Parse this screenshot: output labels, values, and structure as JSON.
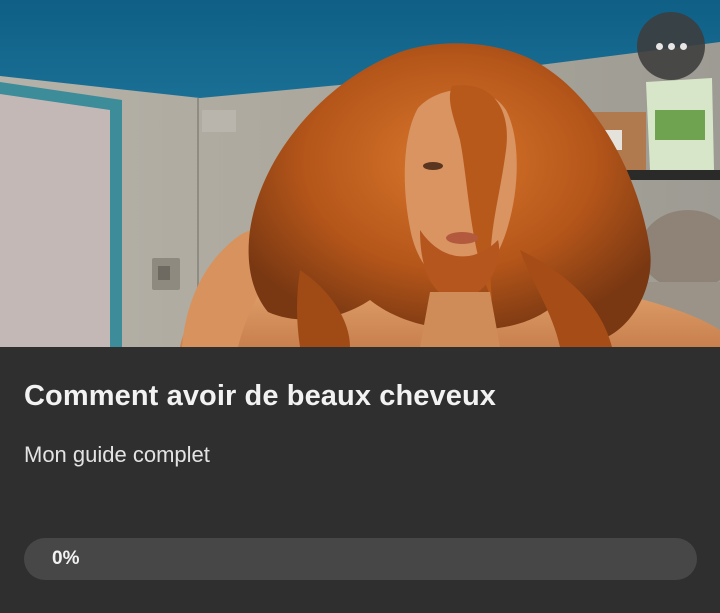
{
  "card": {
    "title": "Comment avoir de beaux cheveux",
    "subtitle": "Mon guide complet",
    "progress": {
      "label": "0%",
      "fraction": 0
    }
  },
  "icons": {
    "more": "more-horizontal-icon"
  },
  "colors": {
    "panel_background": "#2f2f2f",
    "progress_track": "#474747",
    "text": "#f2f2f2"
  }
}
